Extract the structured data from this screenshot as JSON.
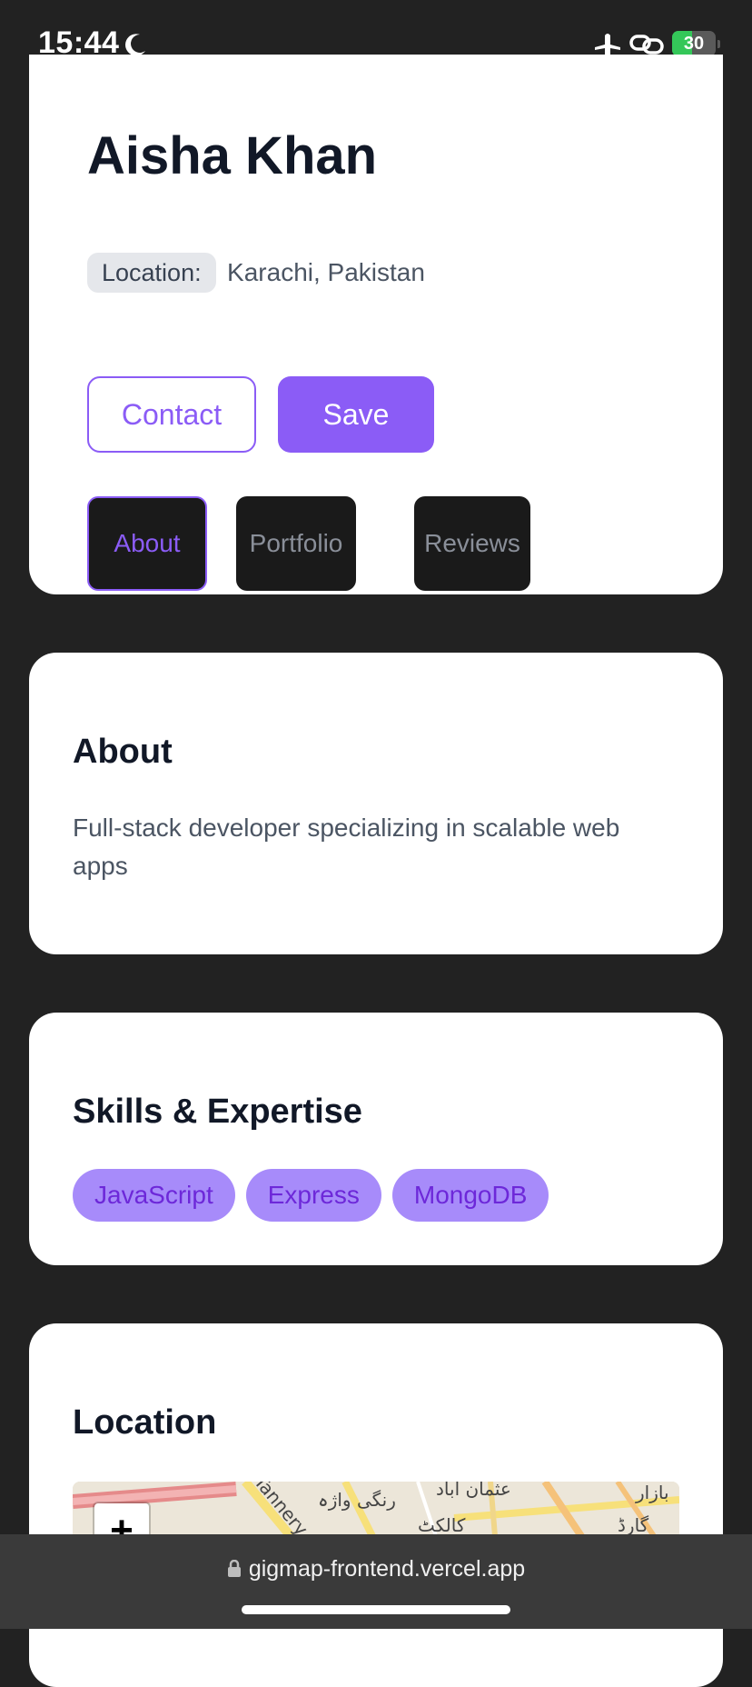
{
  "status_bar": {
    "time": "15:44",
    "battery_level": "30",
    "icons": [
      "moon-icon",
      "airplane-icon",
      "link-icon",
      "battery-icon"
    ],
    "battery_color": "#34c759"
  },
  "profile": {
    "name": "Aisha Khan",
    "location_label": "Location:",
    "location_value": "Karachi, Pakistan",
    "contact_label": "Contact",
    "save_label": "Save",
    "tabs": [
      {
        "label": "About",
        "active": true
      },
      {
        "label": "Portfolio",
        "active": false
      },
      {
        "label": "Reviews",
        "active": false
      }
    ]
  },
  "about": {
    "title": "About",
    "text": "Full-stack developer specializing in scalable web apps"
  },
  "skills": {
    "title": "Skills & Expertise",
    "items": [
      "JavaScript",
      "Express",
      "MongoDB"
    ]
  },
  "location_section": {
    "title": "Location",
    "map_zoom_in": "+",
    "map_labels": [
      "رنگی واژہ",
      "کالکٹ",
      "عثمان آباد",
      "بازار",
      "Tannery",
      "گارڈ"
    ]
  },
  "browser": {
    "url": "gigmap-frontend.vercel.app"
  },
  "colors": {
    "accent": "#8b5cf6",
    "background": "#222222",
    "card": "#ffffff"
  }
}
